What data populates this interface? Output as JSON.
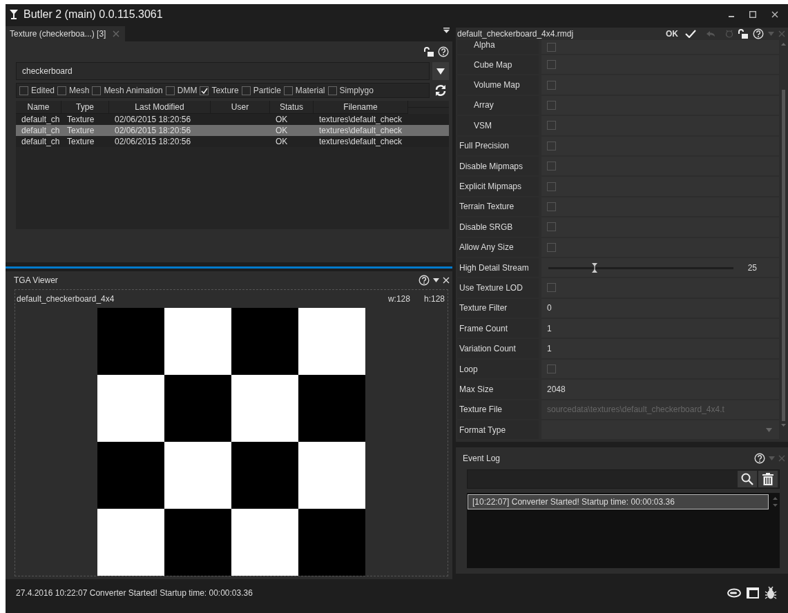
{
  "window": {
    "title": "Butler 2 (main) 0.0.115.3061"
  },
  "search_panel": {
    "tab": {
      "label": "Texture (checkerboa...) [3]",
      "selected": true
    },
    "search": {
      "value": "checkerboard"
    },
    "filters": [
      {
        "label": "Edited",
        "checked": false
      },
      {
        "label": "Mesh",
        "checked": false
      },
      {
        "label": "Mesh Animation",
        "checked": false
      },
      {
        "label": "DMM",
        "checked": false
      },
      {
        "label": "Texture",
        "checked": true
      },
      {
        "label": "Particle",
        "checked": false
      },
      {
        "label": "Material",
        "checked": false
      },
      {
        "label": "Simplygo",
        "checked": false
      }
    ],
    "table": {
      "columns": [
        "Name",
        "Type",
        "Last Modified",
        "User",
        "Status",
        "Filename"
      ],
      "rows": [
        {
          "name": "default_ch",
          "type": "Texture",
          "last_modified": "02/06/2015 18:20:56",
          "status": "OK",
          "filename": "textures\\default_check",
          "selected": false
        },
        {
          "name": "default_ch",
          "type": "Texture",
          "last_modified": "02/06/2015 18:20:56",
          "status": "OK",
          "filename": "textures\\default_check",
          "selected": true
        },
        {
          "name": "default_ch",
          "type": "Texture",
          "last_modified": "02/06/2015 18:20:56",
          "status": "OK",
          "filename": "textures\\default_check",
          "selected": false
        }
      ]
    }
  },
  "viewer": {
    "title": "TGA Viewer",
    "image_name": "default_checkerboard_4x4",
    "width": "w:128",
    "height": "h:128"
  },
  "properties": {
    "file": "default_checkerboard_4x4.rmdj",
    "status": "OK",
    "group_children": [
      {
        "label": "Alpha",
        "kind": "check",
        "checked": false
      },
      {
        "label": "Cube Map",
        "kind": "check",
        "checked": false
      },
      {
        "label": "Volume Map",
        "kind": "check",
        "checked": false
      },
      {
        "label": "Array",
        "kind": "check",
        "checked": false
      },
      {
        "label": "VSM",
        "kind": "check",
        "checked": false
      }
    ],
    "rows": [
      {
        "label": "Full Precision",
        "kind": "check",
        "checked": false
      },
      {
        "label": "Disable Mipmaps",
        "kind": "check",
        "checked": false
      },
      {
        "label": "Explicit Mipmaps",
        "kind": "check",
        "checked": false
      },
      {
        "label": "Terrain Texture",
        "kind": "check",
        "checked": false
      },
      {
        "label": "Disable SRGB",
        "kind": "check",
        "checked": false
      },
      {
        "label": "Allow Any Size",
        "kind": "check",
        "checked": false
      },
      {
        "label": "High Detail Stream",
        "kind": "slider",
        "level": 0.25,
        "reading": "25"
      },
      {
        "label": "Use Texture LOD",
        "kind": "check",
        "checked": false
      },
      {
        "label": "Texture Filter",
        "kind": "value",
        "value": "0"
      },
      {
        "label": "Frame Count",
        "kind": "value",
        "value": "1"
      },
      {
        "label": "Variation Count",
        "kind": "value",
        "value": "1"
      },
      {
        "label": "Loop",
        "kind": "check",
        "checked": false
      },
      {
        "label": "Max Size",
        "kind": "value",
        "value": "2048"
      },
      {
        "label": "Texture File",
        "kind": "file",
        "value": "sourcedata\\textures\\default_checkerboard_4x4.t"
      },
      {
        "label": "Format Type",
        "kind": "dropdown"
      }
    ]
  },
  "event_log": {
    "title": "Event Log",
    "entries": [
      {
        "text": "[10:22:07] Converter Started! Startup time: 00:00:03.36",
        "selected": true
      }
    ]
  },
  "status_bar": {
    "message": "27.4.2016 10:22:07 Converter Started! Startup time: 00:00:03.36"
  }
}
